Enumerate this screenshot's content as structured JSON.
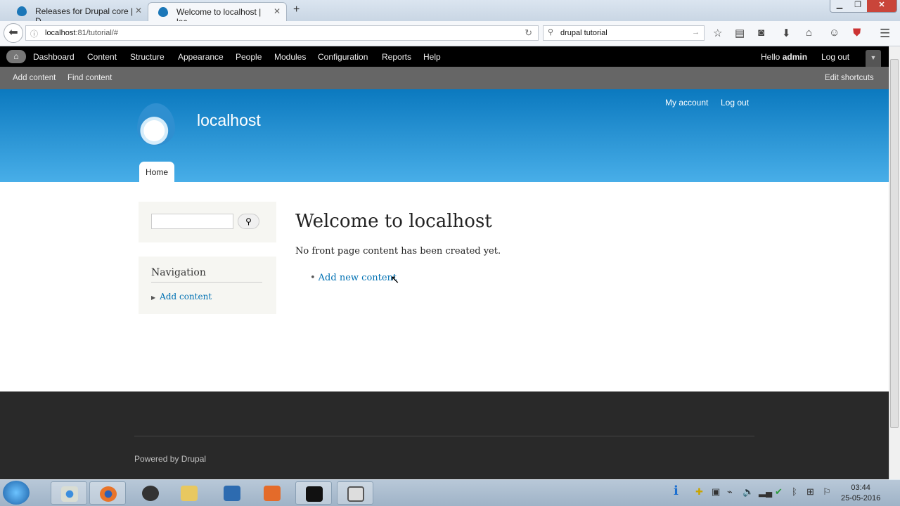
{
  "browser": {
    "tabs": [
      {
        "label": "Releases for Drupal core | D..."
      },
      {
        "label": "Welcome to localhost | loc..."
      }
    ],
    "new_tab": "+",
    "url_host": "localhost",
    "url_rest": ":81/tutorial/#",
    "search_value": "drupal tutorial"
  },
  "toolbar": {
    "items": [
      "Dashboard",
      "Content",
      "Structure",
      "Appearance",
      "People",
      "Modules",
      "Configuration",
      "Reports",
      "Help"
    ],
    "hello": "Hello ",
    "user": "admin",
    "logout": "Log out"
  },
  "shortcuts": {
    "items": [
      "Add content",
      "Find content"
    ],
    "edit": "Edit shortcuts"
  },
  "header": {
    "site_name": "localhost",
    "my_account": "My account",
    "logout": "Log out",
    "tab_home": "Home"
  },
  "sidebar": {
    "nav_title": "Navigation",
    "nav_item": "Add content"
  },
  "main": {
    "title": "Welcome to localhost",
    "message": "No front page content has been created yet.",
    "link": "Add new content"
  },
  "footer": {
    "powered": "Powered by Drupal"
  },
  "taskbar": {
    "time": "03:44",
    "date": "25-05-2016"
  }
}
